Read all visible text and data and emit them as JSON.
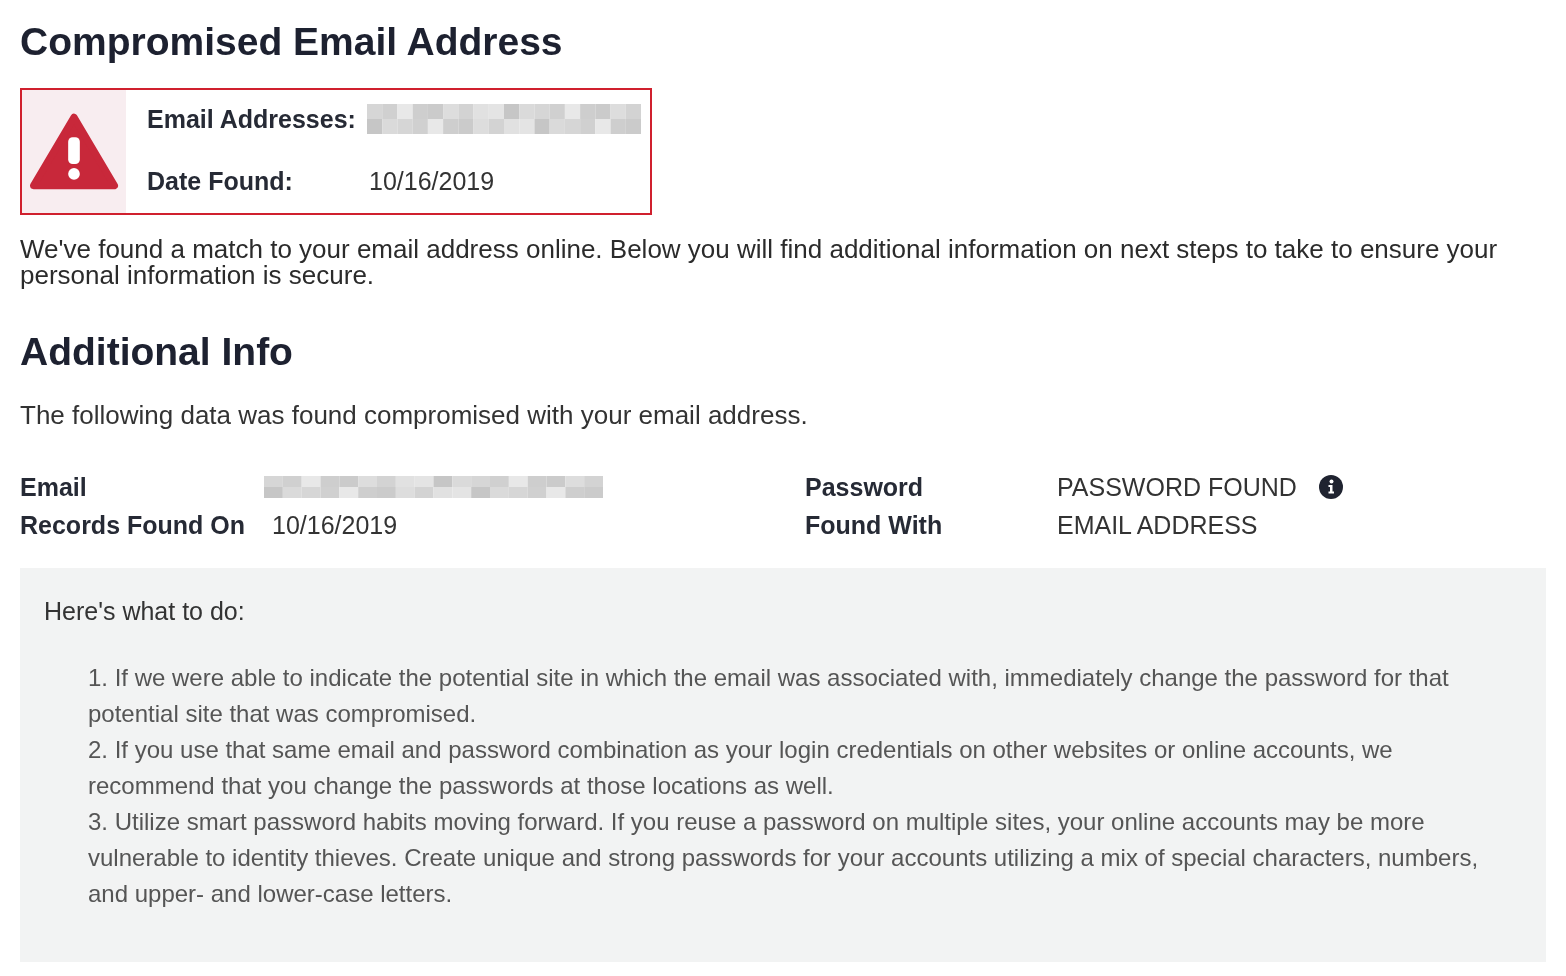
{
  "alert": {
    "title": "Compromised Email Address",
    "fields": [
      {
        "label": "Email Addresses:",
        "redacted": true
      },
      {
        "label": "Date Found:",
        "value": "10/16/2019",
        "redacted": false
      }
    ],
    "message": "We've found a match to your email address online. Below you will find additional information on next steps to take to ensure your personal information is secure."
  },
  "additional_info": {
    "title": "Additional Info",
    "intro": "The following data was found compromised with your email address.",
    "details": [
      {
        "label": "Email",
        "redacted": true,
        "info": false
      },
      {
        "label": "Password",
        "value": "PASSWORD FOUND",
        "redacted": false,
        "info": true
      },
      {
        "label": "Records Found On",
        "value": "10/16/2019",
        "redacted": false,
        "info": false
      },
      {
        "label": "Found With",
        "value": "EMAIL ADDRESS",
        "redacted": false,
        "info": false
      }
    ]
  },
  "next_steps": {
    "heading": "Here's what to do:",
    "items": [
      "1. If we were able to indicate the potential site in which the email was associated with, immediately change the password for that potential site that was compromised.",
      "2. If you use that same email and password combination as your login credentials on other websites or online accounts, we recommend that you change the passwords at those locations as well.",
      "3. Utilize smart password habits moving forward. If you reuse a password on multiple sites, your online accounts may be more vulnerable to identity thieves. Create unique and strong passwords for your accounts utilizing a mix of special characters, numbers, and upper- and lower-case letters."
    ]
  }
}
